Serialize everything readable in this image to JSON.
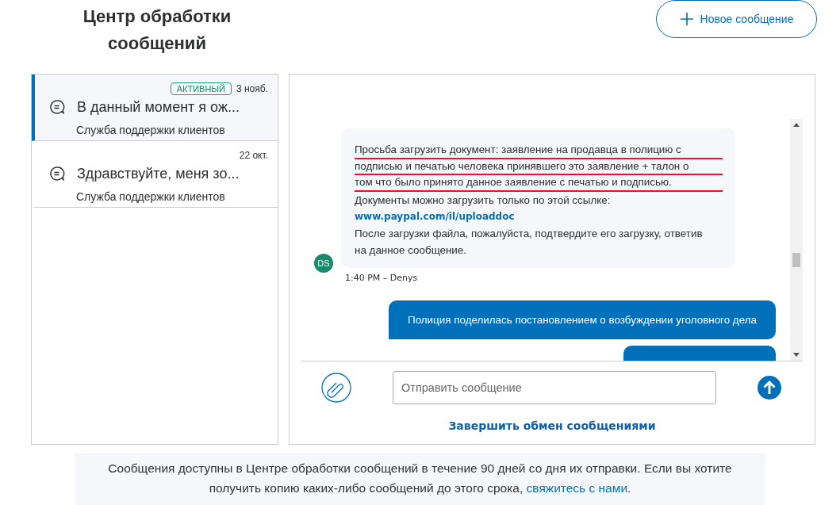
{
  "header": {
    "title": "Центр обработки сообщений",
    "new_button": "Новое сообщение"
  },
  "conversations": [
    {
      "badge": "АКТИВНЫЙ",
      "date": "3 нояб.",
      "subject": "В данный момент я ож...",
      "sender": "Служба поддержки клиентов",
      "selected": true
    },
    {
      "date": "22 окт.",
      "subject": "Здравствуйте, меня зо...",
      "sender": "Служба поддержки клиентов",
      "selected": false
    }
  ],
  "messages": [
    {
      "kind": "incoming",
      "avatar": "DS",
      "lines": [
        {
          "text": "Просьба загрузить документ: заявление на продавца в полицию с",
          "underlined": true
        },
        {
          "text": "подписью и печатью человека принявшего это заявление + талон о",
          "underlined": true
        },
        {
          "text": "том что было принято данное заявление с печатью и подписью.",
          "underlined": true
        },
        {
          "text": "Документы можно загрузить только по этой ссылке:",
          "underlined": false
        },
        {
          "text": "www.paypal.com/il/uploaddoc",
          "kind": "link"
        },
        {
          "text": "После загрузки файла, пожалуйста, подтвердите его загрузку, ответив",
          "underlined": false
        },
        {
          "text": "на данное сообщение.",
          "underlined": false
        }
      ],
      "meta": "1:40 PM – Denys"
    },
    {
      "kind": "outgoing",
      "text": "Полиция поделилась постановлением о возбуждении уголовного дела"
    }
  ],
  "compose": {
    "placeholder": "Отправить сообщение"
  },
  "end_link": "Завершить обмен сообщениями",
  "footer": {
    "text": "Сообщения доступны в Центре обработки сообщений в течение 90 дней со дня их отправки. Если вы хотите получить копию каких-либо сообщений до этого срока,",
    "link": "свяжитесь с нами",
    "tail": "."
  }
}
